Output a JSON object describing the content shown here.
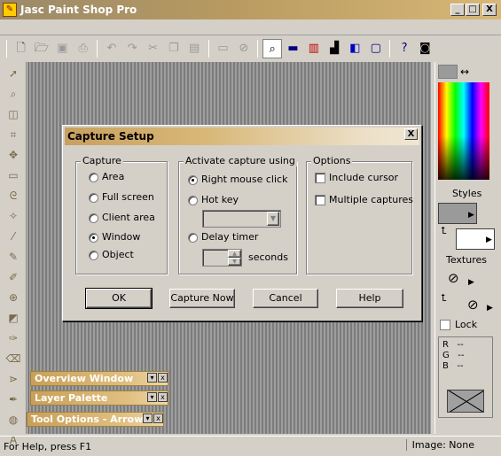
{
  "app": {
    "title": "Jasc Paint Shop Pro"
  },
  "window_controls": {
    "minimize": "_",
    "maximize": "□",
    "close": "X"
  },
  "dialog": {
    "title": "Capture Setup",
    "close_glyph": "X",
    "capture_group": {
      "label": "Capture",
      "options": [
        "Area",
        "Full screen",
        "Client area",
        "Window",
        "Object"
      ],
      "selected": "Window"
    },
    "activate_group": {
      "label": "Activate capture using",
      "options": [
        "Right mouse click",
        "Hot key",
        "Delay timer"
      ],
      "selected": "Right mouse click",
      "delay_unit": "seconds"
    },
    "options_group": {
      "label": "Options",
      "include_cursor": "Include cursor",
      "multiple_captures": "Multiple captures"
    },
    "buttons": {
      "ok": "OK",
      "capture_now": "Capture Now",
      "cancel": "Cancel",
      "help": "Help"
    }
  },
  "palettes": {
    "overview": "Overview Window",
    "layer": "Layer Palette",
    "tool_options": "Tool Options - Arrow",
    "collapse_glyph": "▾",
    "close_glyph": "x"
  },
  "color_panel": {
    "styles_label": "Styles",
    "textures_label": "Textures",
    "lock_label": "Lock",
    "rgb": {
      "r_label": "R",
      "g_label": "G",
      "b_label": "B",
      "r_value": "--",
      "g_value": "--",
      "b_value": "--"
    }
  },
  "status": {
    "left": "For Help, press F1",
    "right": "Image: None"
  }
}
